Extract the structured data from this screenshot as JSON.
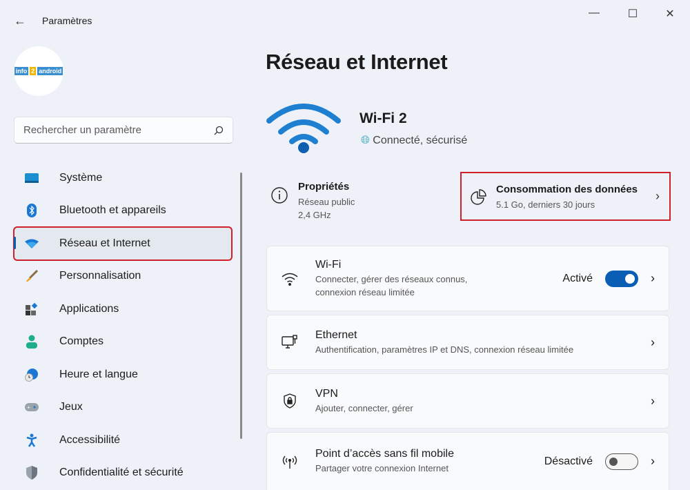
{
  "window": {
    "title": "Paramètres",
    "minimize": "—",
    "maximize": "☐",
    "close": "✕",
    "back": "←"
  },
  "profile": {
    "logo_text": "info2android"
  },
  "search": {
    "placeholder": "Rechercher un paramètre"
  },
  "sidebar": {
    "items": [
      {
        "label": "Système",
        "icon": "monitor-icon"
      },
      {
        "label": "Bluetooth et appareils",
        "icon": "bluetooth-icon"
      },
      {
        "label": "Réseau et Internet",
        "icon": "wifi-icon",
        "active": true
      },
      {
        "label": "Personnalisation",
        "icon": "brush-icon"
      },
      {
        "label": "Applications",
        "icon": "apps-icon"
      },
      {
        "label": "Comptes",
        "icon": "person-icon"
      },
      {
        "label": "Heure et langue",
        "icon": "clock-globe-icon"
      },
      {
        "label": "Jeux",
        "icon": "gamepad-icon"
      },
      {
        "label": "Accessibilité",
        "icon": "accessibility-icon"
      },
      {
        "label": "Confidentialité et sécurité",
        "icon": "shield-icon"
      }
    ]
  },
  "main": {
    "title": "Réseau et Internet",
    "network": {
      "name": "Wi-Fi 2",
      "status": "Connecté, sécurisé"
    },
    "properties": {
      "title": "Propriétés",
      "line1": "Réseau public",
      "line2": "2,4 GHz"
    },
    "usage": {
      "title": "Consommation des données",
      "subtitle": "5.1 Go, derniers 30 jours"
    },
    "cards": [
      {
        "title": "Wi-Fi",
        "subtitle": "Connecter, gérer des réseaux connus,",
        "subtitle2": "connexion réseau limitée",
        "state": "Activé",
        "toggle": true
      },
      {
        "title": "Ethernet",
        "subtitle": "Authentification, paramètres IP et DNS, connexion réseau limitée"
      },
      {
        "title": "VPN",
        "subtitle": "Ajouter, connecter, gérer"
      },
      {
        "title": "Point d’accès sans fil mobile",
        "subtitle": "Partager votre connexion Internet",
        "state": "Désactivé",
        "toggle": false
      }
    ]
  },
  "colors": {
    "accent": "#0a5fb4",
    "highlight": "#d0202a",
    "background": "#eef2f8"
  }
}
